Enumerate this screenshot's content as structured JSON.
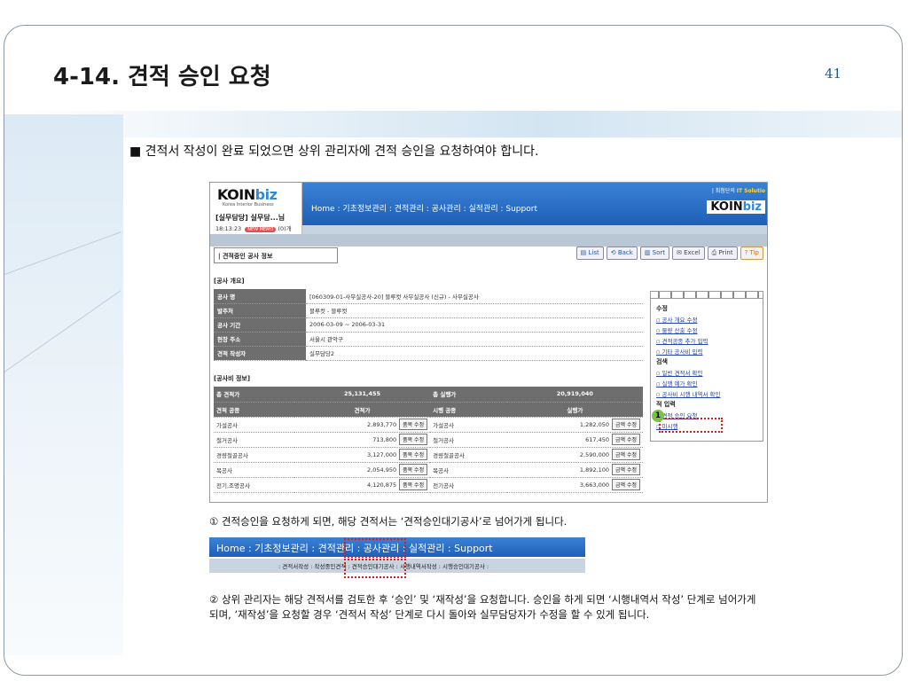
{
  "slide": {
    "title": "4-14. 견적 승인 요청",
    "page_number": "41",
    "bullet": "■ 견적서 작성이 완료 되었으면 상위 관리자에 견적 승인을 요청하여야 합니다.",
    "note1": "① 견적승인을 요청하게 되면, 해당 견적서는 ‘견적승인대기공사’로 넘어가게 됩니다.",
    "note2": "② 상위 관리자는 해당 견적서를 검토한 후 ‘승인’ 및 ‘재작성’을 요청합니다. 승인을 하게 되면 ‘시행내역서 작성’ 단계로 넘어가게 되며, ‘재작성’을 요청할 경우 ‘견적서 작성’ 단계로 다시 돌아와 실무담당자가 수정을 할 수 있게 됩니다.",
    "callout_number": "1"
  },
  "app": {
    "logo_main": "KOIN",
    "logo_accent": "biz",
    "logo_sub": "Korea Interior Business",
    "user_name": "[실무담당] 실무담...님",
    "user_time": "18:13:23",
    "user_badge": "NEW MEMO",
    "user_count": "(0)개",
    "nav": "Home  :  기초정보관리  :  견적관리  :  공사관리  :  실적관리  :  Support",
    "header_right_prefix": "| 최첨단의",
    "header_right_brand": "IT Solutio",
    "header_logo_main": "KOIN",
    "header_logo_accent": "biz",
    "panel_title": "| 견적중인 공사 정보",
    "toolbar": {
      "list": "List",
      "back": "Back",
      "sort": "Sort",
      "excel": "Excel",
      "print": "Print",
      "tip": "Tip"
    },
    "section_overview": "[공사 개요]",
    "overview": [
      {
        "key": "공사 명",
        "value": "[060309-01-사무실공사-20] 블루컷 사무실공사 (신규) - 사무실공사"
      },
      {
        "key": "발주처",
        "value": "블루컷 - 블루컷"
      },
      {
        "key": "공사 기간",
        "value": "2006-03-09 ~ 2006-03-31"
      },
      {
        "key": "현장 주소",
        "value": "서울시 관악구"
      },
      {
        "key": "견적 작성자",
        "value": "실무담당2"
      }
    ],
    "section_cost": "[공사비 정보]",
    "cost_summary": {
      "total_estimate_label": "총 견적가",
      "total_estimate_value": "25,131,455",
      "total_exec_label": "총 실행가",
      "total_exec_value": "20,919,040"
    },
    "cost_headers": {
      "est_type": "견적 공종",
      "est_price": "견적가",
      "exec_type": "시행 공종",
      "exec_price": "실행가"
    },
    "cost_rows": [
      {
        "est_type": "가설공사",
        "est_price": "2,893,770",
        "est_btn": "품목 수정",
        "exec_type": "가설공사",
        "exec_price": "1,282,050",
        "exec_btn": "금액 수정"
      },
      {
        "est_type": "철거공사",
        "est_price": "713,800",
        "est_btn": "품목 수정",
        "exec_type": "철거공사",
        "exec_price": "617,450",
        "exec_btn": "금액 수정"
      },
      {
        "est_type": "경량철골공사",
        "est_price": "3,127,000",
        "est_btn": "품목 수정",
        "exec_type": "경량철골공사",
        "exec_price": "2,590,000",
        "exec_btn": "금액 수정"
      },
      {
        "est_type": "목공사",
        "est_price": "2,054,950",
        "est_btn": "품목 수정",
        "exec_type": "목공사",
        "exec_price": "1,892,100",
        "exec_btn": "금액 수정"
      },
      {
        "est_type": "전기,조명공사",
        "est_price": "4,120,875",
        "est_btn": "품목 수정",
        "exec_type": "전기공사",
        "exec_price": "3,663,000",
        "exec_btn": "금액 수정"
      }
    ],
    "side_menu": {
      "edit_head": "수정",
      "edit_items": [
        "공사 개요 수정",
        "물량 산출 수정",
        "견적공종 추가 입력",
        "기타 공사비 입력"
      ],
      "search_head": "검색",
      "search_items": [
        "일반 견적서 확인",
        "실행 예가 확인",
        "공사비 시행 내역서 확인"
      ],
      "input_head": "적 입력",
      "input_items": [
        "견적 승인 요청",
        "미시행"
      ]
    }
  },
  "nav_strip": {
    "main": "Home  :  기초정보관리  :  견적관리  :  공사관리  :  실적관리  :  Support",
    "sub": ":  견적서작성  :  작성중인견적  :  견적승인대기공사  :  시행내역서작성  :  시행승인대기공사  :"
  },
  "colors": {
    "header_blue": "#1f5fb8",
    "highlight_red": "#e01818",
    "callout_green": "#7cc243",
    "page_number_blue": "#1e5a9c"
  }
}
